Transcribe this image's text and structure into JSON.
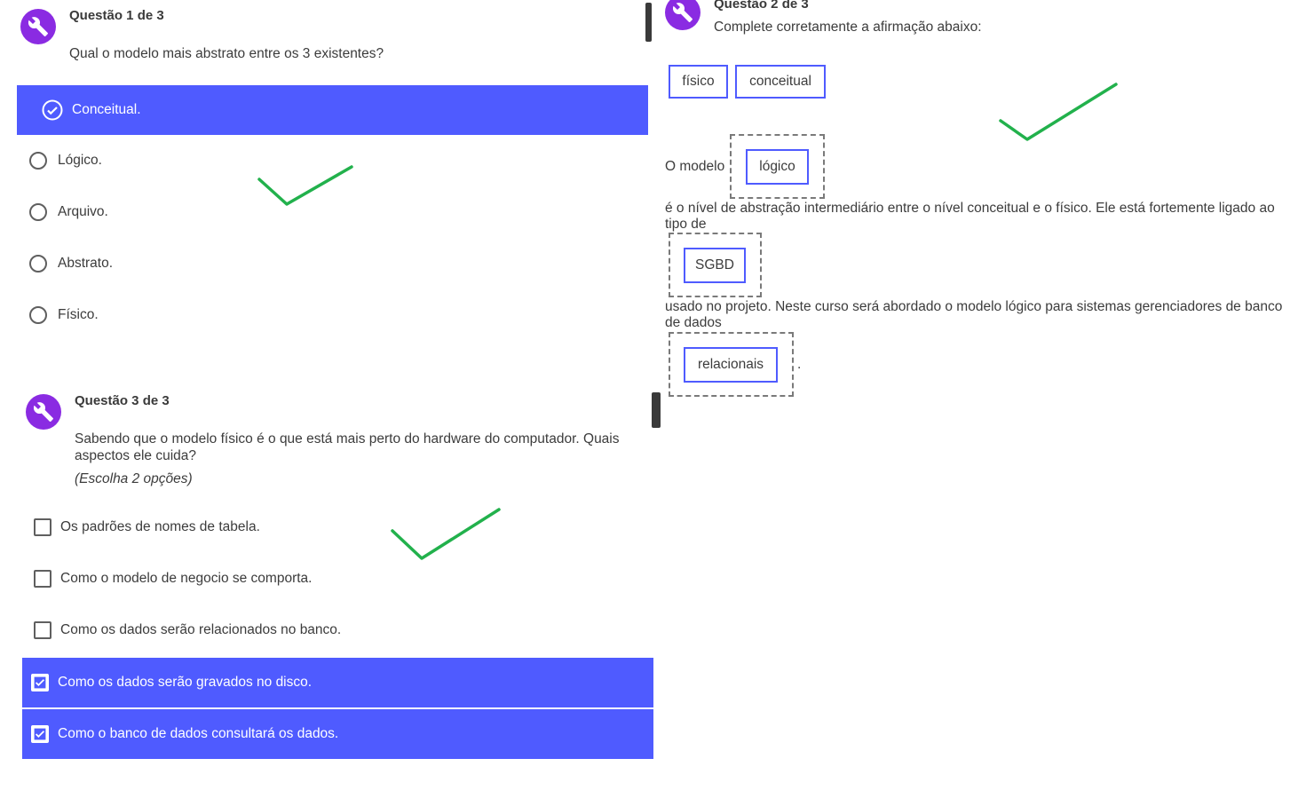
{
  "q1": {
    "title": "Questão 1 de 3",
    "prompt": "Qual o modelo mais abstrato entre os 3 existentes?",
    "options": [
      "Conceitual.",
      "Lógico.",
      "Arquivo.",
      "Abstrato.",
      "Físico."
    ],
    "selected_index": 0
  },
  "q2": {
    "title": "Questão 2 de 3",
    "prompt": "Complete corretamente a afirmação abaixo:",
    "word_bank": [
      "físico",
      "conceitual"
    ],
    "text_1": "O modelo",
    "blank_1": "lógico",
    "text_2": "é o nível de abstração intermediário entre o nível conceitual e o físico. Ele está fortemente ligado ao tipo de",
    "blank_2": "SGBD",
    "text_3": "usado no projeto. Neste curso será abordado o modelo lógico para sistemas gerenciadores de banco de dados",
    "blank_3": "relacionais",
    "text_end": "."
  },
  "q3": {
    "title": "Questão 3 de 3",
    "prompt": "Sabendo que o modelo físico é o que está mais perto do hardware do computador. Quais aspectos ele cuida?",
    "hint": "(Escolha 2 opções)",
    "options": [
      "Os padrões de nomes de tabela.",
      "Como o modelo de negocio se comporta.",
      "Como os dados serão relacionados no banco.",
      "Como os dados serão gravados no disco.",
      "Como o banco de dados consultará os dados."
    ],
    "selected": [
      3,
      4
    ]
  },
  "colors": {
    "accent": "#4f5bff",
    "badge": "#8a2be2",
    "annotation_check": "#22b14c"
  },
  "icons": {
    "badge": "wrench-icon",
    "annotation": "checkmark-annotation-icon"
  }
}
